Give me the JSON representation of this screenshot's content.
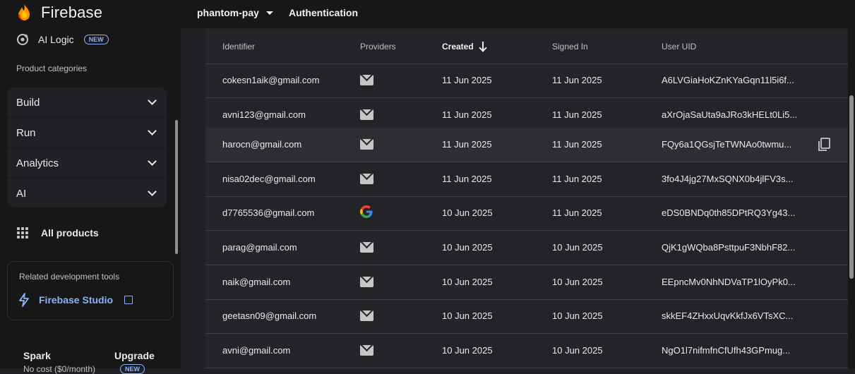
{
  "topbar": {
    "brand": "Firebase",
    "project": "phantom-pay",
    "page_title": "Authentication"
  },
  "sidebar": {
    "ai_logic": {
      "label": "AI Logic",
      "badge": "NEW"
    },
    "categories_heading": "Product categories",
    "categories": [
      {
        "label": "Build"
      },
      {
        "label": "Run"
      },
      {
        "label": "Analytics"
      },
      {
        "label": "AI"
      }
    ],
    "all_products": "All products",
    "dev_tools": {
      "heading": "Related development tools",
      "studio": "Firebase Studio"
    },
    "plan": {
      "name": "Spark",
      "cost": "No cost ($0/month)",
      "upgrade": "Upgrade",
      "badge": "NEW"
    }
  },
  "table": {
    "headers": {
      "identifier": "Identifier",
      "providers": "Providers",
      "created": "Created",
      "signed_in": "Signed In",
      "uid": "User UID"
    },
    "rows": [
      {
        "identifier": "cokesn1aik@gmail.com",
        "provider": "email",
        "created": "11 Jun 2025",
        "signed_in": "11 Jun 2025",
        "uid": "A6LVGiaHoKZnKYaGqn11l5i6f..."
      },
      {
        "identifier": "avni123@gmail.com",
        "provider": "email",
        "created": "11 Jun 2025",
        "signed_in": "11 Jun 2025",
        "uid": "aXrOjaSaUta9aJRo3kHELt0Li5..."
      },
      {
        "identifier": "harocn@gmail.com",
        "provider": "email",
        "created": "11 Jun 2025",
        "signed_in": "11 Jun 2025",
        "uid": "FQy6a1QGsjTeTWNAo0twmu..."
      },
      {
        "identifier": "nisa02dec@gmail.com",
        "provider": "email",
        "created": "11 Jun 2025",
        "signed_in": "11 Jun 2025",
        "uid": "3fo4J4jg27MxSQNX0b4jlFV3s..."
      },
      {
        "identifier": "d7765536@gmail.com",
        "provider": "google",
        "created": "10 Jun 2025",
        "signed_in": "11 Jun 2025",
        "uid": "eDS0BNDq0th85DPtRQ3Yg43..."
      },
      {
        "identifier": "parag@gmail.com",
        "provider": "email",
        "created": "10 Jun 2025",
        "signed_in": "10 Jun 2025",
        "uid": "QjK1gWQba8PsttpuF3NbhF82..."
      },
      {
        "identifier": "naik@gmail.com",
        "provider": "email",
        "created": "10 Jun 2025",
        "signed_in": "10 Jun 2025",
        "uid": "EEpncMv0NhNDVaTP1lOyPk0..."
      },
      {
        "identifier": "geetasn09@gmail.com",
        "provider": "email",
        "created": "10 Jun 2025",
        "signed_in": "10 Jun 2025",
        "uid": "skkEF4ZHxxUqvKkfJx6VTsXC..."
      },
      {
        "identifier": "avni@gmail.com",
        "provider": "email",
        "created": "10 Jun 2025",
        "signed_in": "10 Jun 2025",
        "uid": "NgO1l7nifmfnCfUfh43GPmug..."
      }
    ]
  },
  "colors": {
    "accent": "#8ab4f8",
    "background": "#202124",
    "sidebar": "#171717"
  }
}
